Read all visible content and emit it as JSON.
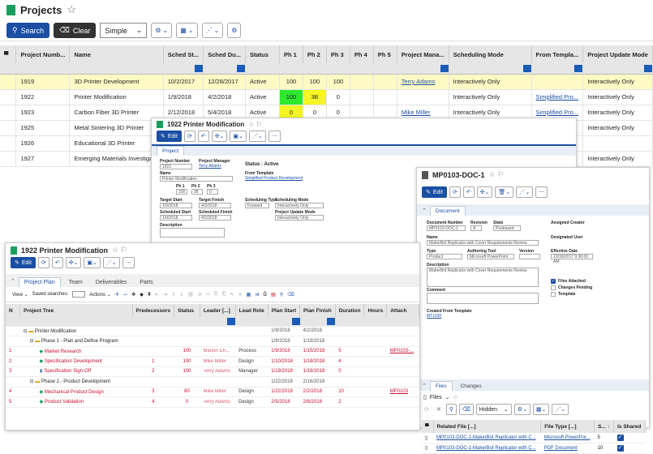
{
  "header": {
    "title": "Projects",
    "star": "☆"
  },
  "toolbar": {
    "search": "Search",
    "clear": "Clear",
    "view": "Simple"
  },
  "grid": {
    "columns": [
      "Project Numb...",
      "Name",
      "Sched St...",
      "Sched Du...",
      "Status",
      "Ph 1",
      "Ph 2",
      "Ph 3",
      "Ph 4",
      "Ph 5",
      "Project Mana...",
      "Scheduling Mode",
      "From Templa...",
      "Project Update Mode"
    ],
    "rows": [
      {
        "num": "1919",
        "name": "3D Printer Development",
        "start": "10/2/2017",
        "end": "12/28/2017",
        "status": "Active",
        "ph1": "100",
        "ph2": "100",
        "ph3": "100",
        "mgr": "Terry Adams",
        "mode": "Interactively Only",
        "tmpl": "",
        "upd": "Interactively Only"
      },
      {
        "num": "1922",
        "name": "Printer Modification",
        "start": "1/9/2018",
        "end": "4/2/2018",
        "status": "Active",
        "ph1": "100",
        "ph2": "38",
        "ph3": "0",
        "mgr": "",
        "mode": "Interactively Only",
        "tmpl": "Simplified Pro...",
        "upd": "Interactively Only"
      },
      {
        "num": "1923",
        "name": "Carbon Fiber 3D Printer",
        "start": "2/12/2018",
        "end": "5/4/2018",
        "status": "Active",
        "ph1": "0",
        "ph2": "0",
        "ph3": "0",
        "mgr": "Mike Miller",
        "mode": "Interactively Only",
        "tmpl": "Simplified Pro...",
        "upd": "Interactively Only"
      },
      {
        "num": "1925",
        "name": "Metal Sintering 3D Printer",
        "start": "",
        "end": "",
        "status": "",
        "ph1": "",
        "ph2": "",
        "ph3": "",
        "mgr": "",
        "mode": "",
        "tmpl": "",
        "upd": "Interactively Only"
      },
      {
        "num": "1926",
        "name": "Educational 3D Printer",
        "start": "",
        "end": "",
        "status": "",
        "ph1": "",
        "ph2": "",
        "ph3": "",
        "mgr": "",
        "mode": "",
        "tmpl": "",
        "upd": ""
      },
      {
        "num": "1927",
        "name": "Emerging Materials Investigat",
        "start": "",
        "end": "",
        "status": "",
        "ph1": "",
        "ph2": "",
        "ph3": "",
        "mgr": "",
        "mode": "",
        "tmpl": "",
        "upd": "Interactively Only"
      }
    ]
  },
  "popup": {
    "title": "1922 Printer Modification",
    "edit": "Edit",
    "tab": "Project",
    "labels": {
      "pnum": "Project Number",
      "pmgr": "Project Manager",
      "name": "Name",
      "tmpl": "From Template",
      "ph1": "Ph 1",
      "ph2": "Ph 2",
      "ph3": "Ph 3",
      "tstart": "Target Start",
      "tfinish": "Target Finish",
      "stype": "Scheduling Type",
      "smode": "Scheduling Mode",
      "sstart": "Scheduled Start",
      "sfinish": "Scheduled Finish",
      "umode": "Project Update Mode",
      "desc": "Description"
    },
    "values": {
      "pnum": "1922",
      "pmgr": "Terry Adams",
      "status": "Status : Active",
      "name": "Printer Modification",
      "tmpl": "Simplified Product Development",
      "ph1": "100",
      "ph2": "38",
      "ph3": "0",
      "tstart": "1/9/2018",
      "tfinish": "4/2/2018",
      "stype": "Forward",
      "smode": "Interactively Only",
      "sstart": "1/9/2018",
      "sfinish": "4/2/2018",
      "umode": "Interactively Only"
    }
  },
  "doc": {
    "title": "MP0103-DOC-1",
    "edit": "Edit",
    "tab": "Document",
    "labels": {
      "dnum": "Document Number",
      "rev": "Revision",
      "state": "State",
      "creator": "Assigned Creator",
      "name": "Name",
      "designated": "Designated User",
      "type": "Type",
      "tool": "Authoring Tool",
      "version": "Version",
      "eff": "Effective Date",
      "desc": "Description",
      "files": "Files Attached",
      "changes": "Changes Pending",
      "template": "Template",
      "comment": "Comment",
      "from": "Created From Template"
    },
    "values": {
      "dnum": "MP0103-DOC-1",
      "rev": "A",
      "state": "Preleased",
      "name": "MakerBot Replicator with Cover Requirements Review",
      "type": "Product",
      "tool": "Microsoft PowerPoint",
      "eff": "10/30/2017 9:30:00 AM",
      "desc": "MakerBot Replicator with Cover Requirements Review",
      "from": "MT1030"
    },
    "subtabs": [
      "Files",
      "Changes"
    ],
    "files_title": "Files",
    "hidden": "Hidden",
    "file_cols": [
      "Related File [...]",
      "File Type [...]",
      "S... ↑",
      "Is Shared"
    ],
    "file_rows": [
      {
        "file": "MP0103-DOC-1-MakerBot Replicator with C...",
        "type": "Microsoft PowerPoi...",
        "s": "5"
      },
      {
        "file": "MP0103-DOC-1-MakerBot Replicator with C...",
        "type": "PDF Document",
        "s": "10"
      }
    ]
  },
  "plan": {
    "title": "1922 Printer Modification",
    "edit": "Edit",
    "tabs": [
      "Project Plan",
      "Team",
      "Deliverables",
      "Parts"
    ],
    "view": "View",
    "saved": "Saved searches:",
    "actions": "Actions",
    "cols": [
      "N",
      "Project Tree",
      "Predecessors",
      "Status",
      "Leader [...]",
      "Lead Role",
      "Plan Start",
      "Plan Finish",
      "Duration",
      "Hours",
      "Attach"
    ],
    "rows": [
      {
        "n": "",
        "tree": "Printer Modification",
        "pred": "",
        "status": "",
        "leader": "",
        "role": "",
        "start": "1/9/2018",
        "finish": "4/2/2018",
        "dur": "",
        "attach": "",
        "red": false,
        "lvl": 0
      },
      {
        "n": "",
        "tree": "Phase 1 - Plan and Define Program",
        "pred": "",
        "status": "",
        "leader": "",
        "role": "",
        "start": "1/9/2018",
        "finish": "1/19/2018",
        "dur": "",
        "attach": "",
        "red": false,
        "lvl": 1
      },
      {
        "n": "1",
        "tree": "Market Research",
        "pred": "",
        "status": "100",
        "leader": "Marion Ch...",
        "role": "Process",
        "start": "1/9/2018",
        "finish": "1/15/2018",
        "dur": "5",
        "attach": "MP0103-...",
        "red": true,
        "lvl": 2
      },
      {
        "n": "2",
        "tree": "Specification Development",
        "pred": "1",
        "status": "100",
        "leader": "Mike Miller",
        "role": "Design",
        "start": "1/10/2018",
        "finish": "1/19/2018",
        "dur": "4",
        "attach": "",
        "red": true,
        "lvl": 2
      },
      {
        "n": "3",
        "tree": "Specification Sign-Off",
        "pred": "2",
        "status": "100",
        "leader": "Terry Adams",
        "role": "Manager",
        "start": "1/19/2018",
        "finish": "1/19/2018",
        "dur": "0",
        "attach": "",
        "red": true,
        "lvl": 2
      },
      {
        "n": "",
        "tree": "Phase 2 - Product Development",
        "pred": "",
        "status": "",
        "leader": "",
        "role": "",
        "start": "1/22/2018",
        "finish": "2/16/2018",
        "dur": "",
        "attach": "",
        "red": false,
        "lvl": 1
      },
      {
        "n": "4",
        "tree": "Mechanical Product Design",
        "pred": "3",
        "status": "80",
        "leader": "Mike Miller",
        "role": "Design",
        "start": "1/22/2018",
        "finish": "2/2/2018",
        "dur": "10",
        "attach": "MP0103",
        "red": true,
        "lvl": 2
      },
      {
        "n": "5",
        "tree": "Product Validation",
        "pred": "4",
        "status": "0",
        "leader": "Terry Adams",
        "role": "Design",
        "start": "2/5/2018",
        "finish": "2/6/2018",
        "dur": "2",
        "attach": "",
        "red": true,
        "lvl": 2
      }
    ]
  }
}
